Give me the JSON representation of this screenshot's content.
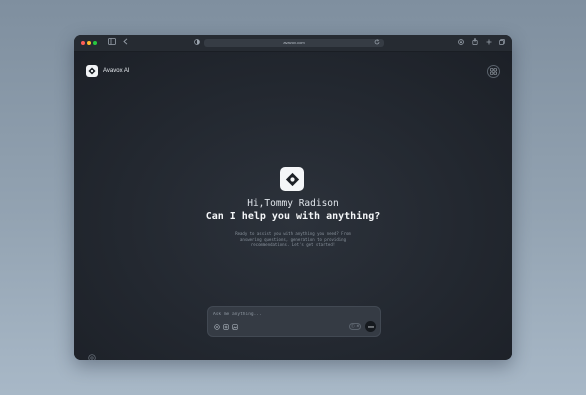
{
  "browser": {
    "url": "avavox.com",
    "icons": [
      "sidebar-toggle-icon",
      "back-icon",
      "shield-icon",
      "reload-icon",
      "download-icon",
      "share-icon",
      "new-tab-icon",
      "tabs-overview-icon"
    ]
  },
  "app": {
    "brand_name": "Avavox AI",
    "greeting": "Hi,Tommy Radison",
    "question": "Can I help you with anything?",
    "description": "Ready to assist you with anything you need? From answering questions, generation to providing recommendations. Let's get started!"
  },
  "composer": {
    "placeholder": "Ask me anything...",
    "value": "",
    "tools": [
      "voice-icon",
      "attach-icon",
      "image-icon"
    ],
    "pill_label": "ⓘ ⌘",
    "send_icon": "more-icon"
  },
  "colors": {
    "accent": "#f4f6f8",
    "surface": "#212730",
    "composer_bg": "#353b44"
  }
}
